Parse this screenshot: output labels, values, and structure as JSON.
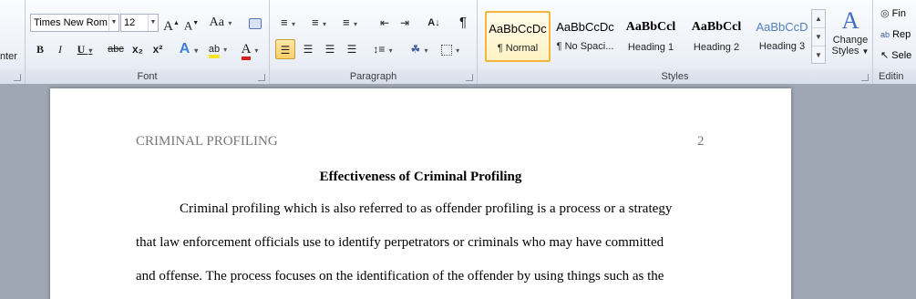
{
  "ribbon": {
    "clipboard_partial": "nter",
    "font": {
      "label": "Font",
      "font_name": "Times New Rom",
      "font_size": "12",
      "grow_glyph": "A",
      "shrink_glyph": "A",
      "case_glyph": "Aa",
      "bold": "B",
      "italic": "I",
      "underline": "U",
      "strike": "abc",
      "subscript": "x₂",
      "superscript": "x²",
      "text_effect": "A",
      "highlight": "ab",
      "font_color": "A"
    },
    "paragraph": {
      "label": "Paragraph",
      "pilcrow": "¶"
    },
    "styles": {
      "label": "Styles",
      "items": [
        {
          "sample": "AaBbCcDc",
          "name": "¶ Normal"
        },
        {
          "sample": "AaBbCcDc",
          "name": "¶ No Spaci..."
        },
        {
          "sample": "AaBbCcl",
          "name": "Heading 1"
        },
        {
          "sample": "AaBbCcl",
          "name": "Heading 2"
        },
        {
          "sample": "AaBbCcD",
          "name": "Heading 3"
        }
      ],
      "change_styles": "Change",
      "change_styles_2": "Styles"
    },
    "editing": {
      "label": "Editin",
      "find": "Fin",
      "replace": "Rep",
      "select": "Sele"
    }
  },
  "document": {
    "header_left": "CRIMINAL PROFILING",
    "page_number": "2",
    "title": "Effectiveness of  Criminal Profiling",
    "lines": [
      "Criminal profiling which is also referred to as offender profiling is a process or a strategy",
      "that law enforcement officials use to identify perpetrators or criminals who may have committed",
      "and offense.  The process focuses on the identification of the offender by using things such as the"
    ]
  },
  "colors": {
    "accent": "#f2b63e",
    "highlight": "#f5e529",
    "font_color_bar": "#d6201c",
    "heading_blue": "#4f81bd",
    "doc_background": "#9ea7b3"
  }
}
